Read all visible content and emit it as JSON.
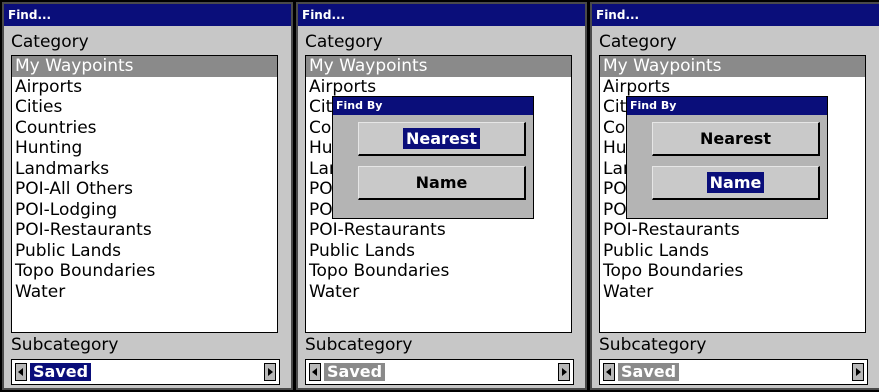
{
  "screens": [
    {
      "title": "Find...",
      "category_label": "Category",
      "categories": [
        "My Waypoints",
        "Airports",
        "Cities",
        "Countries",
        "Hunting",
        "Landmarks",
        "POI-All Others",
        "POI-Lodging",
        "POI-Restaurants",
        "Public Lands",
        "Topo Boundaries",
        "Water"
      ],
      "selected_category": "My Waypoints",
      "subcategory_label": "Subcategory",
      "subcategory_value": "Saved",
      "dialog": null
    },
    {
      "title": "Find...",
      "category_label": "Category",
      "categories": [
        "My Waypoints",
        "Airports",
        "Cities",
        "Countries",
        "Hunting",
        "Landmarks",
        "POI-All Others",
        "POI-Lodging",
        "POI-Restaurants",
        "Public Lands",
        "Topo Boundaries",
        "Water"
      ],
      "selected_category": "My Waypoints",
      "subcategory_label": "Subcategory",
      "subcategory_value": "Saved",
      "dialog": {
        "title": "Find By",
        "buttons": [
          "Nearest",
          "Name"
        ],
        "focused": "Nearest"
      }
    },
    {
      "title": "Find...",
      "category_label": "Category",
      "categories": [
        "My Waypoints",
        "Airports",
        "Cities",
        "Countries",
        "Hunting",
        "Landmarks",
        "POI-All Others",
        "POI-Lodging",
        "POI-Restaurants",
        "Public Lands",
        "Topo Boundaries",
        "Water"
      ],
      "selected_category": "My Waypoints",
      "subcategory_label": "Subcategory",
      "subcategory_value": "Saved",
      "dialog": {
        "title": "Find By",
        "buttons": [
          "Nearest",
          "Name"
        ],
        "focused": "Name"
      }
    }
  ],
  "colors": {
    "titlebar": "#0a0e7a",
    "selection": "#8a8a8a",
    "screen_bg": "#c7c7c7"
  }
}
